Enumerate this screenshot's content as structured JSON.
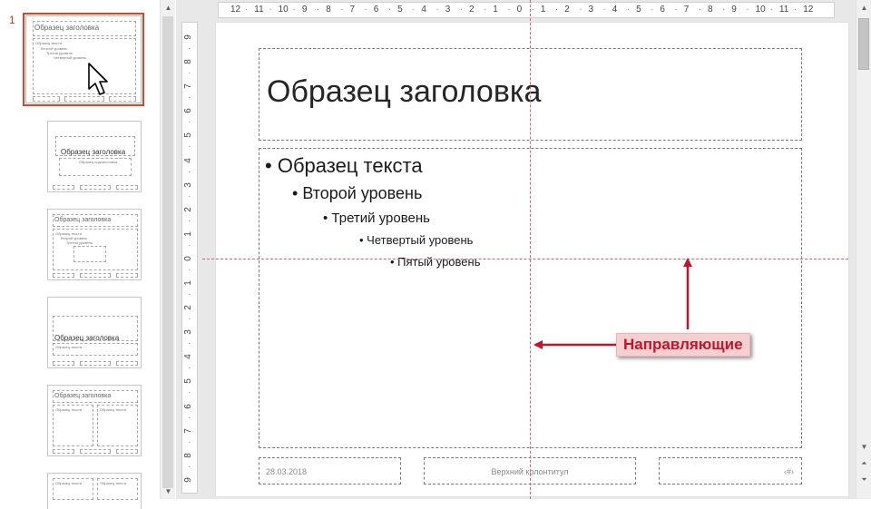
{
  "thumbnails": {
    "first_slide_number": "1",
    "items": [
      {
        "title": "Образец заголовка",
        "text": "Образец текста",
        "level2": "Второй уровень",
        "level3": "Третий уровень",
        "level4": "Четвертый уровень"
      },
      {
        "title": "Образец заголовка",
        "subtitle": "Образец подзаголовка"
      },
      {
        "title": "Образец заголовка",
        "text": "Образец текста",
        "level2": "Второй уровень",
        "level3": "Третий уровень"
      },
      {
        "title": "Образец заголовка",
        "subtitle": "Образец текста"
      },
      {
        "title": "Образец заголовка",
        "text_left": "Образец текста",
        "text_right": "Образец текста"
      },
      {
        "title": "Образец текста",
        "text_left": "Образец текста"
      }
    ]
  },
  "rulers": {
    "horizontal": [
      "12",
      "11",
      "10",
      "9",
      "8",
      "7",
      "6",
      "5",
      "4",
      "3",
      "2",
      "1",
      "0",
      "1",
      "2",
      "3",
      "4",
      "5",
      "6",
      "7",
      "8",
      "9",
      "10",
      "11",
      "12"
    ],
    "vertical": [
      "9",
      "8",
      "7",
      "6",
      "5",
      "4",
      "3",
      "2",
      "1",
      "0",
      "1",
      "2",
      "3",
      "4",
      "5",
      "6",
      "7",
      "8",
      "9"
    ]
  },
  "slide": {
    "title": "Образец заголовка",
    "level1": "Образец текста",
    "level2": "Второй уровень",
    "level3": "Третий уровень",
    "level4": "Четвертый уровень",
    "level5": "Пятый уровень",
    "footer_date": "28.03.2018",
    "footer_center": "Верхний колонтитул",
    "footer_number": "‹#›"
  },
  "annotation": {
    "label": "Направляющие",
    "color": "#c0152b"
  },
  "icons": {
    "cursor": "arrow-cursor-icon",
    "scroll_up": "▲",
    "scroll_down": "▼",
    "prev_slide": "⏶",
    "next_slide": "⏷"
  }
}
